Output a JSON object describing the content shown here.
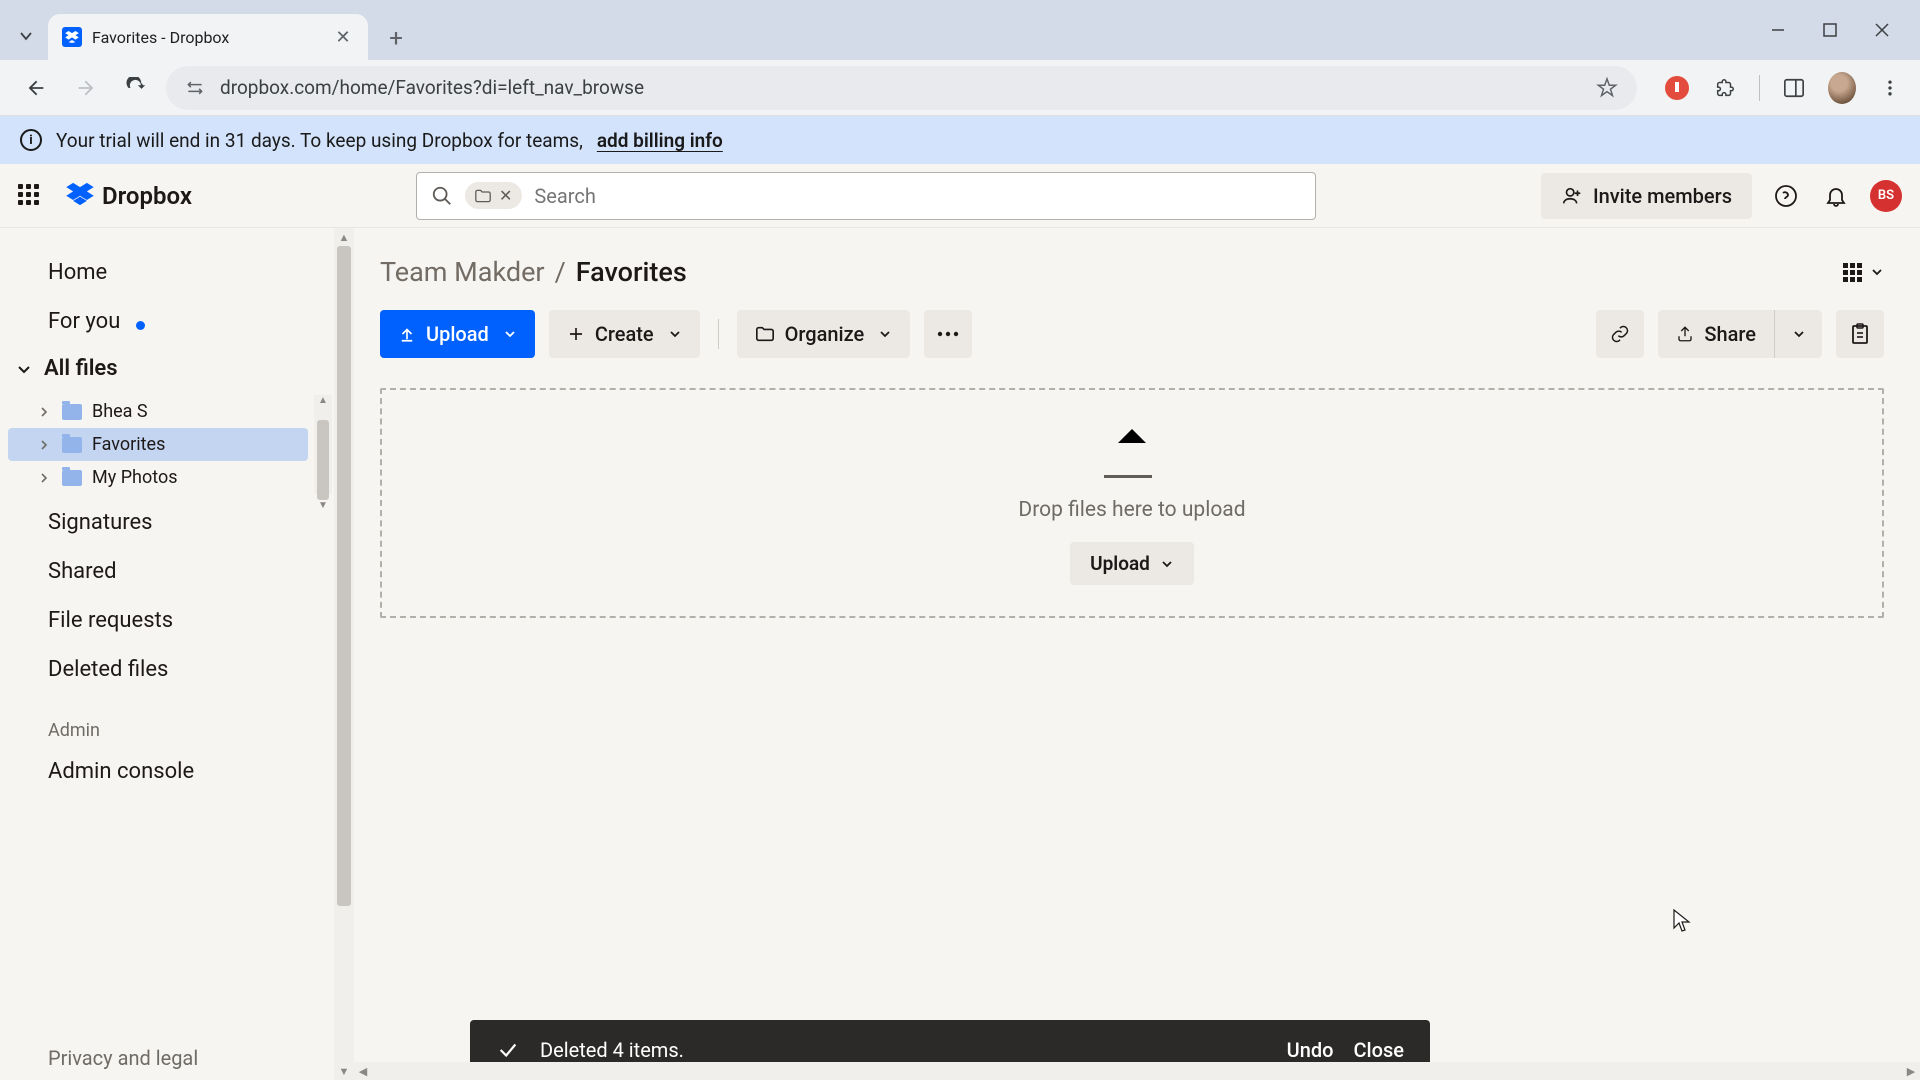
{
  "browser": {
    "tab_title": "Favorites - Dropbox",
    "url": "dropbox.com/home/Favorites?di=left_nav_browse"
  },
  "banner": {
    "text": "Your trial will end in 31 days. To keep using Dropbox for teams,",
    "link": "add billing info"
  },
  "header": {
    "brand": "Dropbox",
    "search_placeholder": "Search",
    "invite": "Invite members",
    "avatar_initials": "BS"
  },
  "sidebar": {
    "home": "Home",
    "for_you": "For you",
    "all_files": "All files",
    "folders": [
      {
        "name": "Bhea S"
      },
      {
        "name": "Favorites"
      },
      {
        "name": "My Photos"
      }
    ],
    "signatures": "Signatures",
    "shared": "Shared",
    "file_requests": "File requests",
    "deleted": "Deleted files",
    "admin_label": "Admin",
    "admin_console": "Admin console",
    "privacy": "Privacy and legal"
  },
  "breadcrumb": {
    "parent": "Team Makder",
    "current": "Favorites"
  },
  "actions": {
    "upload": "Upload",
    "create": "Create",
    "organize": "Organize",
    "share": "Share"
  },
  "dropzone": {
    "text": "Drop files here to upload",
    "button": "Upload"
  },
  "toast": {
    "message": "Deleted 4 items.",
    "undo": "Undo",
    "close": "Close"
  }
}
